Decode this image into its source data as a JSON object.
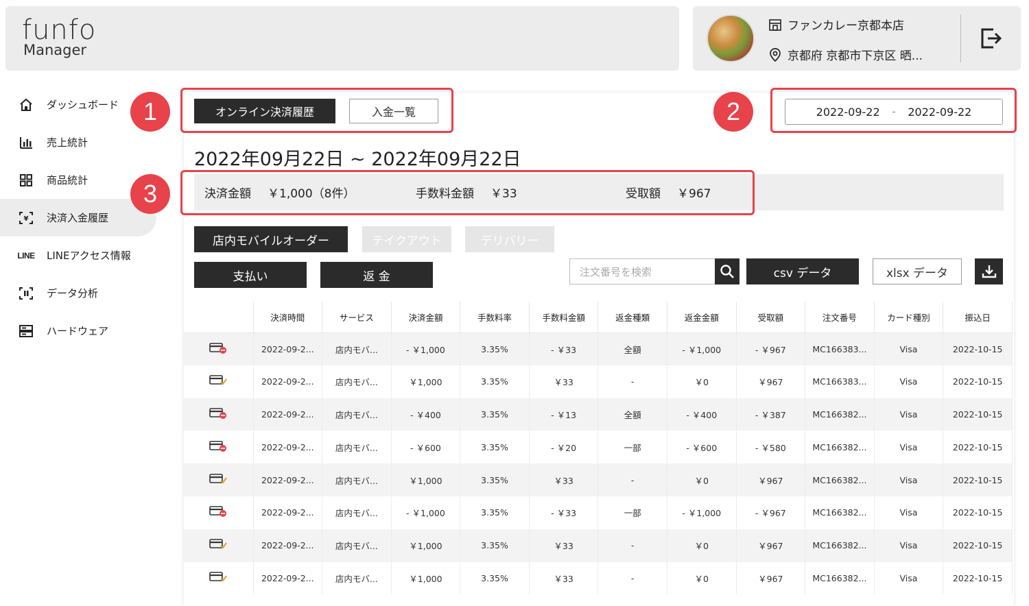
{
  "header": {
    "logo_top": "funfo",
    "logo_bottom": "Manager",
    "store_name": "ファンカレー京都本店",
    "store_address": "京都府 京都市下京区 晒..."
  },
  "sidebar": {
    "items": [
      {
        "label": "ダッシュボード",
        "icon": "home-icon"
      },
      {
        "label": "売上統計",
        "icon": "bar-chart-icon"
      },
      {
        "label": "商品統計",
        "icon": "grid-icon"
      },
      {
        "label": "決済入金履歴",
        "icon": "yen-icon",
        "active": true
      },
      {
        "label": "LINEアクセス情報",
        "icon": "line-logo-icon",
        "icon_text": "LINE"
      },
      {
        "label": "データ分析",
        "icon": "scan-icon"
      },
      {
        "label": "ハードウェア",
        "icon": "hardware-icon"
      }
    ]
  },
  "tabs": {
    "online": "オンライン決済履歴",
    "deposit": "入金一覧"
  },
  "date_range": {
    "start": "2022-09-22",
    "separator": "-",
    "end": "2022-09-22"
  },
  "period_title": "2022年09月22日 ~ 2022年09月22日",
  "summary": {
    "payment_label": "決済金額",
    "payment_value": "￥1,000（8件）",
    "fee_label": "手数料金額",
    "fee_value": "￥33",
    "received_label": "受取額",
    "received_value": "￥967"
  },
  "services": {
    "instore": "店内モバイルオーダー",
    "takeout": "テイクアウト",
    "delivery": "デリバリー"
  },
  "actions": {
    "pay": "支払い",
    "refund": "返 金",
    "search_placeholder": "注文番号を検索",
    "csv": "csv データ",
    "xlsx": "xlsx データ"
  },
  "table": {
    "headers": [
      "",
      "決済時間",
      "サービス",
      "決済金額",
      "手数料率",
      "手数料金額",
      "返金種類",
      "返金金額",
      "受取額",
      "注文番号",
      "カード種別",
      "振込日"
    ],
    "rows": [
      {
        "status": "refund",
        "cells": [
          "2022-09-2...",
          "店内モバ...",
          "- ￥1,000",
          "3.35%",
          "- ￥33",
          "全額",
          "- ￥1,000",
          "- ￥967",
          "MC166383...",
          "Visa",
          "2022-10-15"
        ]
      },
      {
        "status": "paid",
        "cells": [
          "2022-09-2...",
          "店内モバ...",
          "￥1,000",
          "3.35%",
          "￥33",
          "-",
          "￥0",
          "￥967",
          "MC166383...",
          "Visa",
          "2022-10-15"
        ]
      },
      {
        "status": "refund",
        "cells": [
          "2022-09-2...",
          "店内モバ...",
          "- ￥400",
          "3.35%",
          "- ￥13",
          "全額",
          "- ￥400",
          "- ￥387",
          "MC166382...",
          "Visa",
          "2022-10-15"
        ]
      },
      {
        "status": "refund",
        "cells": [
          "2022-09-2...",
          "店内モバ...",
          "- ￥600",
          "3.35%",
          "- ￥20",
          "一部",
          "- ￥600",
          "- ￥580",
          "MC166382...",
          "Visa",
          "2022-10-15"
        ]
      },
      {
        "status": "paid",
        "cells": [
          "2022-09-2...",
          "店内モバ...",
          "￥1,000",
          "3.35%",
          "￥33",
          "-",
          "￥0",
          "￥967",
          "MC166382...",
          "Visa",
          "2022-10-15"
        ]
      },
      {
        "status": "refund",
        "cells": [
          "2022-09-2...",
          "店内モバ...",
          "- ￥1,000",
          "3.35%",
          "- ￥33",
          "一部",
          "- ￥1,000",
          "- ￥967",
          "MC166382...",
          "Visa",
          "2022-10-15"
        ]
      },
      {
        "status": "paid",
        "cells": [
          "2022-09-2...",
          "店内モバ...",
          "￥1,000",
          "3.35%",
          "￥33",
          "-",
          "￥0",
          "￥967",
          "MC166382...",
          "Visa",
          "2022-10-15"
        ]
      },
      {
        "status": "paid",
        "cells": [
          "2022-09-2...",
          "店内モバ...",
          "￥1,000",
          "3.35%",
          "￥33",
          "-",
          "￥0",
          "￥967",
          "MC166382...",
          "Visa",
          "2022-10-15"
        ]
      }
    ]
  },
  "annotations": {
    "badge1": "1",
    "badge2": "2",
    "badge3": "3"
  },
  "colors": {
    "highlight": "#e8424a",
    "dark_button": "#2b2b2b",
    "refund_icon": "#e8424a",
    "paid_check": "#e0a020"
  }
}
